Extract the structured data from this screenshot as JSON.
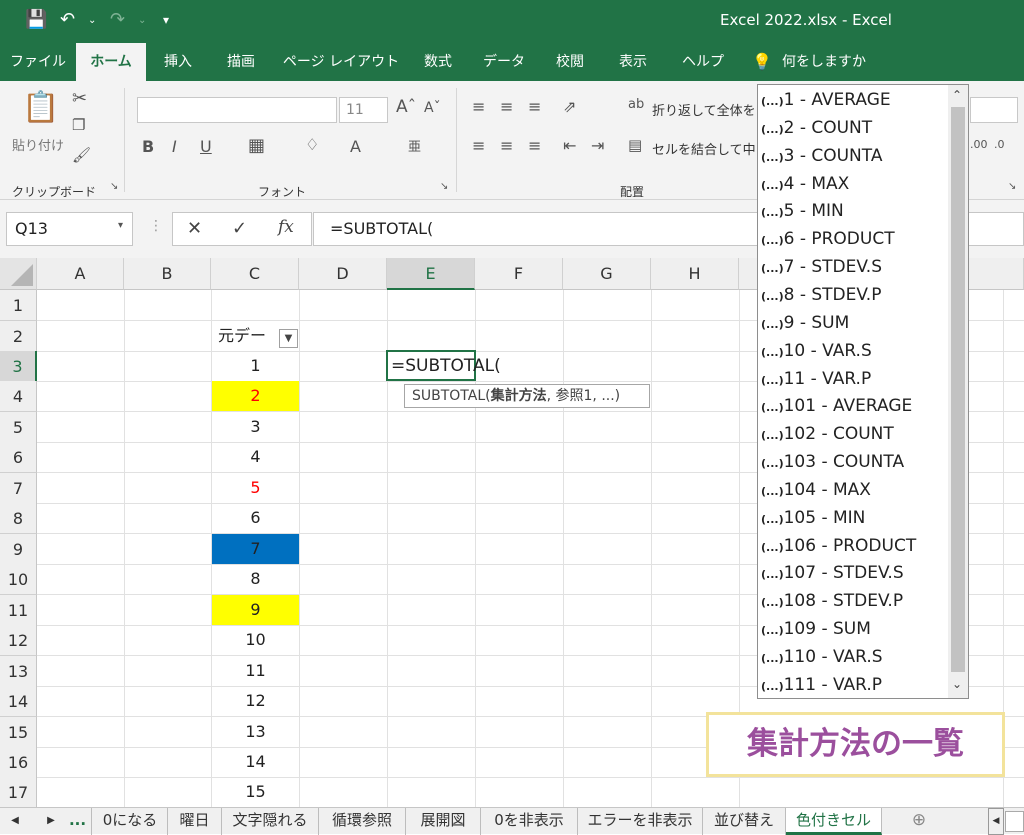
{
  "window": {
    "title": "Excel 2022.xlsx  -  Excel"
  },
  "tabs": [
    "ファイル",
    "ホーム",
    "挿入",
    "描画",
    "ページ レイアウト",
    "数式",
    "データ",
    "校閲",
    "表示",
    "ヘルプ"
  ],
  "active_tab": "ホーム",
  "tell_me": "何をしますか",
  "ribbon": {
    "paste_label": "貼り付け",
    "groups": {
      "clipboard": "クリップボード",
      "font": "フォント",
      "alignment": "配置"
    },
    "font_size": "11",
    "wrap_text": "折り返して全体を",
    "merge_center": "セルを結合して中"
  },
  "formula_bar": {
    "name_box": "Q13",
    "formula": "=SUBTOTAL("
  },
  "grid": {
    "columns": [
      "A",
      "B",
      "C",
      "D",
      "E",
      "F",
      "G",
      "H"
    ],
    "rows": [
      "1",
      "2",
      "3",
      "4",
      "5",
      "6",
      "7",
      "8",
      "9",
      "10",
      "11",
      "12",
      "13",
      "14",
      "15",
      "16",
      "17"
    ],
    "c_header": "元デー",
    "c_values": [
      "1",
      "2",
      "3",
      "4",
      "5",
      "6",
      "7",
      "8",
      "9",
      "10",
      "11",
      "12",
      "13",
      "14",
      "15"
    ],
    "editing_cell": "=SUBTOTAL(",
    "colors": {
      "yellow": "#ffff00",
      "blue": "#0070c0",
      "red": "#ff0000"
    }
  },
  "tooltip": {
    "prefix": "SUBTOTAL(",
    "bold": "集計方法",
    "suffix": ", 参照1, ...)"
  },
  "dropdown": {
    "icon": "(...)",
    "items": [
      "1 - AVERAGE",
      "2 - COUNT",
      "3 - COUNTA",
      "4 - MAX",
      "5 - MIN",
      "6 - PRODUCT",
      "7 - STDEV.S",
      "8 - STDEV.P",
      "9 - SUM",
      "10 - VAR.S",
      "11 - VAR.P",
      "101 - AVERAGE",
      "102 - COUNT",
      "103 - COUNTA",
      "104 - MAX",
      "105 - MIN",
      "106 - PRODUCT",
      "107 - STDEV.S",
      "108 - STDEV.P",
      "109 - SUM",
      "110 - VAR.S",
      "111 - VAR.P"
    ]
  },
  "annotation": "集計方法の一覧",
  "sheet_tabs": [
    "0になる",
    "曜日",
    "文字隠れる",
    "循環参照",
    "展開図",
    "0を非表示",
    "エラーを非表示",
    "並び替え",
    "色付きセル"
  ],
  "active_sheet": "色付きセル",
  "sheet_overflow": "..."
}
